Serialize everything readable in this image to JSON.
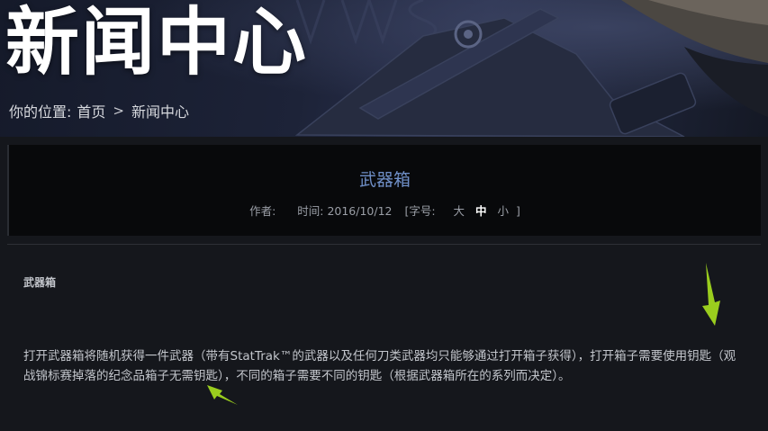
{
  "hero": {
    "title": "新闻中心",
    "breadcrumb": {
      "prefix": "你的位置:",
      "home": "首页",
      "separator": ">",
      "current": "新闻中心"
    }
  },
  "article": {
    "title": "武器箱",
    "meta": {
      "author_label": "作者:",
      "author": "",
      "time_label": "时间:",
      "date": "2016/10/12",
      "font_size_label": "[字号:",
      "font_sizes": [
        "大",
        "中",
        "小"
      ],
      "active_font_size": "中",
      "close_bracket": "]"
    },
    "section_heading": "武器箱",
    "paragraph": "打开武器箱将随机获得一件武器（带有StatTrak™的武器以及任何刀类武器均只能够通过打开箱子获得），打开箱子需要使用钥匙（观战锦标赛掉落的纪念品箱子无需钥匙），不同的箱子需要不同的钥匙（根据武器箱所在的系列而决定）。"
  },
  "colors": {
    "title_accent": "#6f8fc7",
    "annotation_arrow": "#9acd1e",
    "header_box": "#08090b",
    "page_bg": "#15171c"
  }
}
